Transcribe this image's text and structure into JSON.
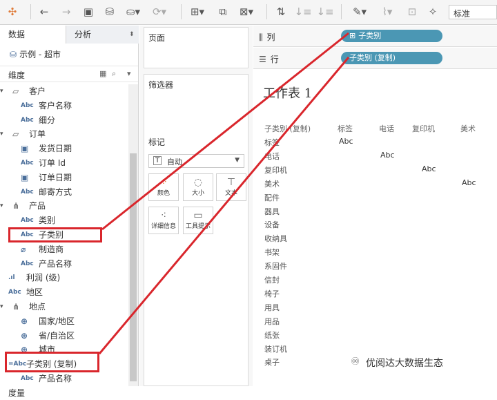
{
  "toolbar": {
    "font_select": "标准",
    "icons": [
      "tableau-logo-icon",
      "back-icon",
      "forward-icon",
      "save-icon",
      "new-datasource-icon",
      "pause-icon",
      "refresh-icon",
      "new-sheet-icon",
      "duplicate-icon",
      "clear-icon",
      "swap-icon",
      "sort-asc-icon",
      "sort-desc-icon",
      "highlight-icon",
      "group-icon",
      "label-icon",
      "pin-icon"
    ]
  },
  "left": {
    "tab_data": "数据",
    "tab_analysis": "分析",
    "datasource": "示例 - 超市",
    "dims_header": "维度",
    "tree": [
      {
        "kind": "folder",
        "label": "客户",
        "icon": "folder-icon"
      },
      {
        "kind": "field",
        "label": "客户名称",
        "icon": "Abc"
      },
      {
        "kind": "field",
        "label": "细分",
        "icon": "Abc"
      },
      {
        "kind": "folder",
        "label": "订单",
        "icon": "folder-icon"
      },
      {
        "kind": "field",
        "label": "发货日期",
        "icon": "date-icon"
      },
      {
        "kind": "field",
        "label": "订单 Id",
        "icon": "Abc"
      },
      {
        "kind": "field",
        "label": "订单日期",
        "icon": "date-icon"
      },
      {
        "kind": "field",
        "label": "邮寄方式",
        "icon": "Abc"
      },
      {
        "kind": "folder",
        "label": "产品",
        "icon": "hierarchy-icon"
      },
      {
        "kind": "field",
        "label": "类别",
        "icon": "Abc"
      },
      {
        "kind": "field",
        "label": "子类别",
        "icon": "Abc"
      },
      {
        "kind": "field",
        "label": "制造商",
        "icon": "paperclip-icon"
      },
      {
        "kind": "field",
        "label": "产品名称",
        "icon": "Abc"
      },
      {
        "kind": "top",
        "label": "利润 (级)",
        "icon": "bin-icon"
      },
      {
        "kind": "top",
        "label": "地区",
        "icon": "Abc"
      },
      {
        "kind": "folder",
        "label": "地点",
        "icon": "hierarchy-icon"
      },
      {
        "kind": "field",
        "label": "国家/地区",
        "icon": "globe-icon"
      },
      {
        "kind": "field",
        "label": "省/自治区",
        "icon": "globe-icon"
      },
      {
        "kind": "field",
        "label": "城市",
        "icon": "globe-icon"
      },
      {
        "kind": "top",
        "label": "子类别 (复制)",
        "icon": "=Abc"
      },
      {
        "kind": "field",
        "label": "产品名称",
        "icon": "Abc"
      },
      {
        "kind": "section",
        "label": "度量"
      }
    ]
  },
  "shelves": {
    "pages": "页面",
    "filters": "筛选器",
    "marks": "标记",
    "marks_type": "自动",
    "mark_buttons": [
      "颜色",
      "大小",
      "文本",
      "详细信息",
      "工具提示"
    ]
  },
  "view": {
    "columns_label": "列",
    "rows_label": "行",
    "columns_pill": "子类别",
    "rows_pill": "子类别 (复制)",
    "sheet_title": "工作表 1",
    "col_header_title": "子类别 (复制)",
    "col_headers": [
      "标签",
      "电话",
      "复印机",
      "美术"
    ],
    "row_labels": [
      "标签",
      "电话",
      "复印机",
      "美术",
      "配件",
      "器具",
      "设备",
      "收纳具",
      "书架",
      "系固件",
      "信封",
      "椅子",
      "用具",
      "用品",
      "纸张",
      "装订机",
      "桌子"
    ],
    "cell_text": "Abc"
  },
  "watermark": "优阅达大数据生态",
  "colors": {
    "pill": "#4b97b4",
    "annotation": "#d9262c"
  }
}
